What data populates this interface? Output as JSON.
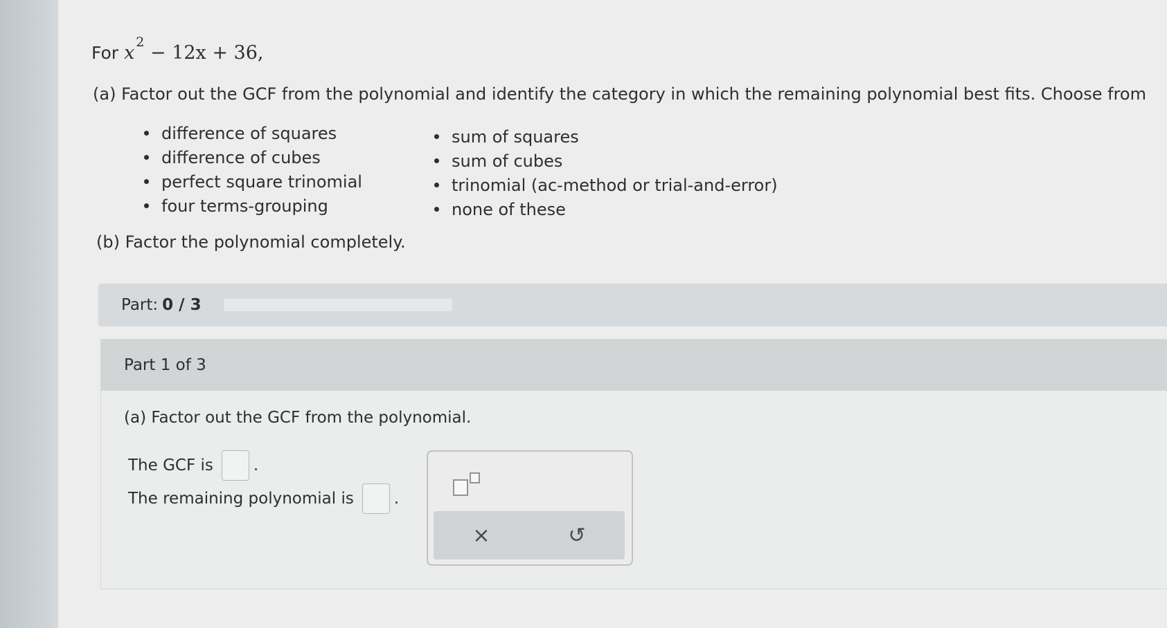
{
  "problem": {
    "prefix": "For",
    "var_x": "x",
    "exponent": "2",
    "rest": "− 12x + 36,"
  },
  "question_a": "(a) Factor out the GCF from the polynomial and identify the category in which the remaining polynomial best fits. Choose from",
  "options_left": [
    "difference of squares",
    "difference of cubes",
    "perfect square trinomial",
    "four terms-grouping"
  ],
  "options_right": [
    "sum of squares",
    "sum of cubes",
    "trinomial (ac-method or trial-and-error)",
    "none of these"
  ],
  "question_b": "(b) Factor the polynomial completely.",
  "progress": {
    "label": "Part:",
    "value_text": "0 / 3",
    "fraction": 0
  },
  "part": {
    "header": "Part 1 of 3",
    "subquestion": "(a) Factor out the GCF from the polynomial.",
    "gcf_label": "The GCF is",
    "remaining_label": "The remaining polynomial is",
    "period": "."
  },
  "palette": {
    "clear_symbol": "×",
    "undo_symbol": "↺",
    "icons": [
      "superscript-template-icon",
      "clear-icon",
      "undo-icon"
    ]
  },
  "colors": {
    "progress_fill": "#3a8fd3"
  }
}
